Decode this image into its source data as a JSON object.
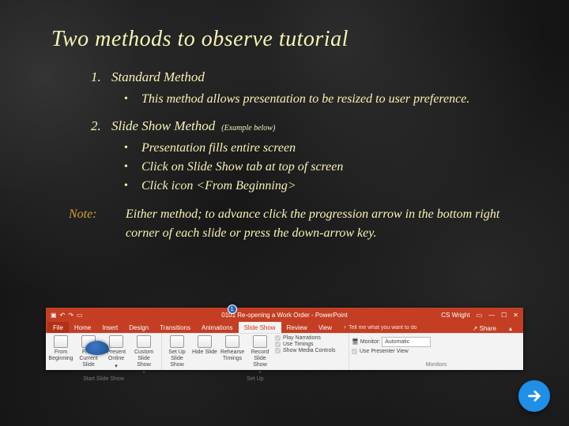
{
  "title": "Two methods to observe tutorial",
  "methods": [
    {
      "num": "1.",
      "name": "Standard Method",
      "example": "",
      "bullets": [
        "This method allows presentation to be resized  to user preference."
      ]
    },
    {
      "num": "2.",
      "name": "Slide Show Method",
      "example": "(Example below)",
      "bullets": [
        "Presentation fills entire screen",
        "Click on Slide Show tab at top of screen",
        "Click icon <From Beginning>"
      ]
    }
  ],
  "note": {
    "label": "Note:",
    "text": "Either method; to advance click the progression arrow in the bottom right corner of each slide or press the down-arrow key."
  },
  "ribbon": {
    "doc_title": "0101 Re-opening a Work Order  -  PowerPoint",
    "user": "CS Wright",
    "bubble": "1",
    "tabs": [
      "File",
      "Home",
      "Insert",
      "Design",
      "Transitions",
      "Animations",
      "Slide Show",
      "Review",
      "View"
    ],
    "active_tab": "Slide Show",
    "tell": "Tell me what you want to do",
    "share": "Share",
    "groups": {
      "start": {
        "label": "Start Slide Show",
        "buttons": [
          "From Beginning",
          "From Current Slide",
          "Present Online",
          "Custom Slide Show"
        ]
      },
      "setup": {
        "label": "Set Up",
        "buttons": [
          "Set Up Slide Show",
          "Hide Slide",
          "Rehearse Timings",
          "Record Slide Show"
        ],
        "checks": [
          "Play Narrations",
          "Use Timings",
          "Show Media Controls"
        ]
      },
      "monitors": {
        "label": "Monitors",
        "monitor_label": "Monitor:",
        "monitor_value": "Automatic",
        "presenter": "Use Presenter View"
      }
    }
  },
  "next": "Next"
}
